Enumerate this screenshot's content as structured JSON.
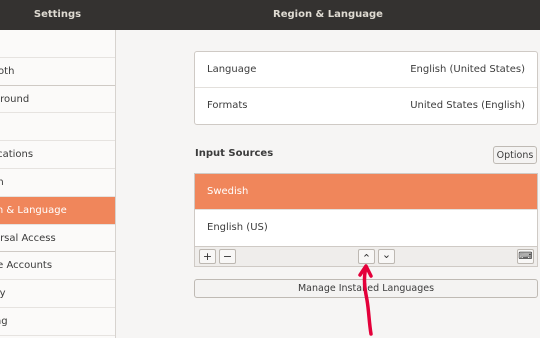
{
  "window": {
    "sidebar_title": "Settings",
    "panel_title": "Region & Language"
  },
  "sidebar": {
    "items": [
      {
        "label": "i"
      },
      {
        "label": "tooth"
      },
      {
        "label": "kground"
      },
      {
        "label": "k"
      },
      {
        "label": "ifications"
      },
      {
        "label": "rch"
      },
      {
        "label": "ion & Language"
      },
      {
        "label": "versal Access"
      },
      {
        "label": "ine Accounts"
      },
      {
        "label": "acy"
      },
      {
        "label": "ring"
      }
    ]
  },
  "language_panel": {
    "language_label": "Language",
    "language_value": "English (United States)",
    "formats_label": "Formats",
    "formats_value": "United States (English)"
  },
  "input_sources": {
    "title": "Input Sources",
    "options_label": "Options",
    "items": [
      {
        "label": "Swedish"
      },
      {
        "label": "English (US)"
      }
    ],
    "add_label": "+",
    "remove_label": "−",
    "up_label": "⌃",
    "down_label": "⌄",
    "keyboard_label": "⌨"
  },
  "manage_label": "Manage Installed Languages",
  "colors": {
    "accent": "#f0865b",
    "annotation": "#e4003a"
  }
}
